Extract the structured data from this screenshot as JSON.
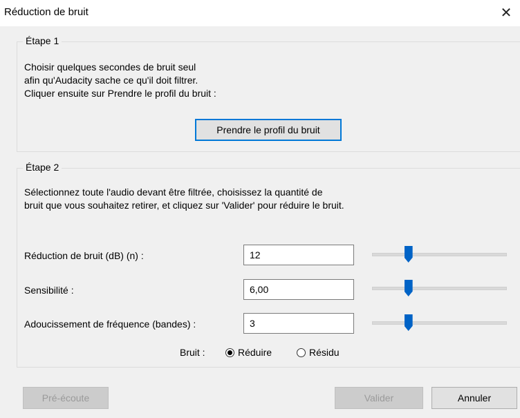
{
  "window": {
    "title": "Réduction de bruit",
    "close_glyph": "✕"
  },
  "step1": {
    "label": "Étape 1",
    "lines": [
      "Choisir quelques secondes de bruit seul",
      "afin qu'Audacity sache ce qu'il doit filtrer.",
      "Cliquer ensuite sur Prendre le profil du bruit :"
    ],
    "button": "Prendre le profil du bruit"
  },
  "step2": {
    "label": "Étape 2",
    "lines": [
      "Sélectionnez toute l'audio devant être filtrée, choisissez la quantité de",
      "bruit que vous souhaitez retirer, et cliquez sur 'Valider' pour réduire le bruit."
    ],
    "params": [
      {
        "label": "Réduction de bruit (dB) (n) :",
        "value": "12",
        "slider_fraction": 0.27
      },
      {
        "label": "Sensibilité :",
        "value": "6,00",
        "slider_fraction": 0.27
      },
      {
        "label": "Adoucissement de fréquence (bandes) :",
        "value": "3",
        "slider_fraction": 0.27
      }
    ],
    "noise_label": "Bruit :",
    "options": [
      {
        "label": "Réduire",
        "selected": true
      },
      {
        "label": "Résidu",
        "selected": false
      }
    ]
  },
  "footer": {
    "preview": "Pré-écoute",
    "ok": "Valider",
    "cancel": "Annuler"
  }
}
